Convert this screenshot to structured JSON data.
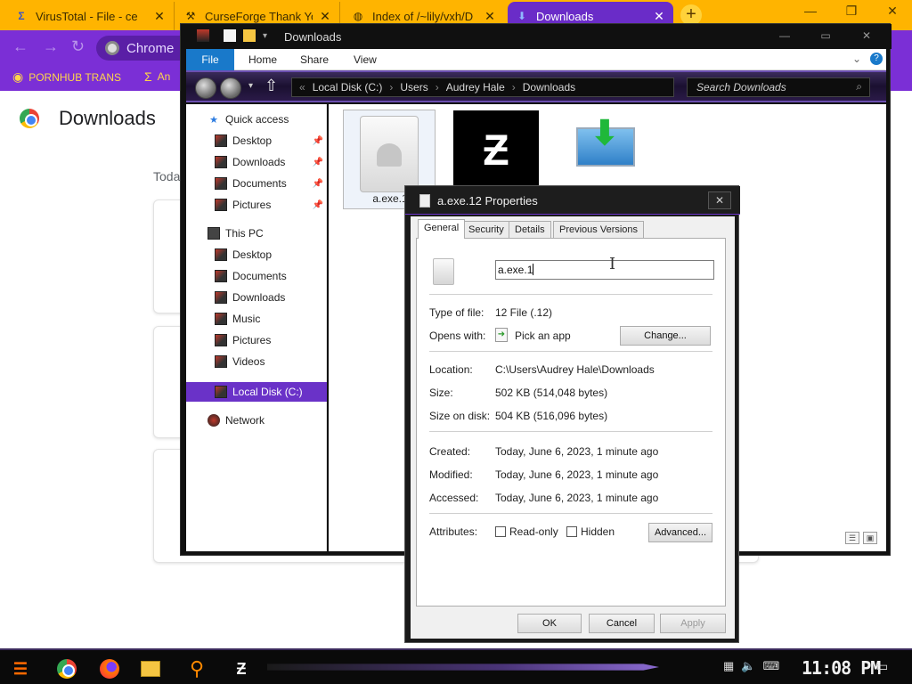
{
  "browser": {
    "tabs": [
      {
        "title": "VirusTotal - File - ce",
        "icon": "virustotal-icon"
      },
      {
        "title": "CurseForge Thank You",
        "icon": "curseforge-icon"
      },
      {
        "title": "Index of /~lily/vxh/D",
        "icon": "globe-icon"
      },
      {
        "title": "Downloads",
        "icon": "download-icon"
      }
    ],
    "omnibox_text": "Chrome",
    "bookmarks": [
      {
        "label": "PORNHUB TRANS"
      },
      {
        "label": "An"
      }
    ],
    "page_title": "Downloads",
    "date_group": "Toda",
    "accent": "#7b2fd6",
    "tabstrip_color": "#ffb400"
  },
  "explorer": {
    "title": "Downloads",
    "ribbon": {
      "file": "File",
      "home": "Home",
      "share": "Share",
      "view": "View"
    },
    "breadcrumb": [
      "Local Disk (C:)",
      "Users",
      "Audrey Hale",
      "Downloads"
    ],
    "search_placeholder": "Search Downloads",
    "nav": {
      "quick_access": "Quick access",
      "quick_items": [
        "Desktop",
        "Downloads",
        "Documents",
        "Pictures"
      ],
      "this_pc": "This PC",
      "pc_items": [
        "Desktop",
        "Documents",
        "Downloads",
        "Music",
        "Pictures",
        "Videos"
      ],
      "selected": "Local Disk (C:)",
      "network": "Network"
    },
    "files": [
      {
        "name": "a.exe.1"
      }
    ]
  },
  "properties": {
    "title": "a.exe.12 Properties",
    "tabs": [
      "General",
      "Security",
      "Details",
      "Previous Versions"
    ],
    "filename_value": "a.exe.1",
    "labels": {
      "type": "Type of file:",
      "opens": "Opens with:",
      "location": "Location:",
      "size": "Size:",
      "size_on_disk": "Size on disk:",
      "created": "Created:",
      "modified": "Modified:",
      "accessed": "Accessed:",
      "attributes": "Attributes:"
    },
    "values": {
      "type": "12 File (.12)",
      "opens": "Pick an app",
      "location": "C:\\Users\\Audrey Hale\\Downloads",
      "size": "502 KB (514,048 bytes)",
      "size_on_disk": "504 KB (516,096 bytes)",
      "created": "Today, June 6, 2023, 1 minute ago",
      "modified": "Today, June 6, 2023, 1 minute ago",
      "accessed": "Today, June 6, 2023, 1 minute ago"
    },
    "checkboxes": {
      "readonly": "Read-only",
      "hidden": "Hidden"
    },
    "buttons": {
      "change": "Change...",
      "advanced": "Advanced...",
      "ok": "OK",
      "cancel": "Cancel",
      "apply": "Apply"
    }
  },
  "taskbar": {
    "clock": "11:08 PM"
  }
}
